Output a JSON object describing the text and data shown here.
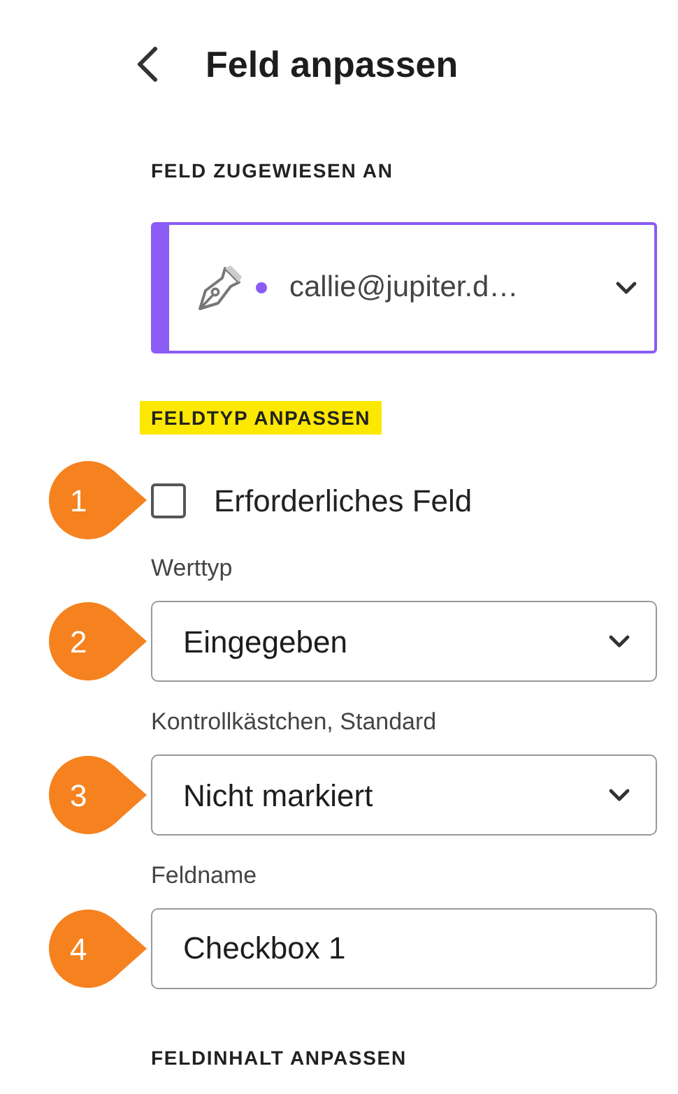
{
  "title": "Feld anpassen",
  "assigned_section": {
    "heading": "FELD ZUGEWIESEN AN",
    "highlighted": false,
    "recipient": {
      "email": "callie@jupiter.d…",
      "color": "#8a5cf5"
    }
  },
  "field_type_section": {
    "heading": "FELDTYP ANPASSEN",
    "highlighted": true,
    "controls": [
      {
        "kind": "checkbox",
        "callout": "1",
        "label": "Erforderliches Feld",
        "checked": false
      },
      {
        "kind": "select",
        "callout": "2",
        "label": "Werttyp",
        "value": "Eingegeben"
      },
      {
        "kind": "select",
        "callout": "3",
        "label": "Kontrollkästchen, Standard",
        "value": "Nicht markiert"
      },
      {
        "kind": "text",
        "callout": "4",
        "label": "Feldname",
        "value": "Checkbox 1"
      }
    ]
  },
  "content_section": {
    "heading": "FELDINHALT ANPASSEN",
    "highlighted": false
  }
}
